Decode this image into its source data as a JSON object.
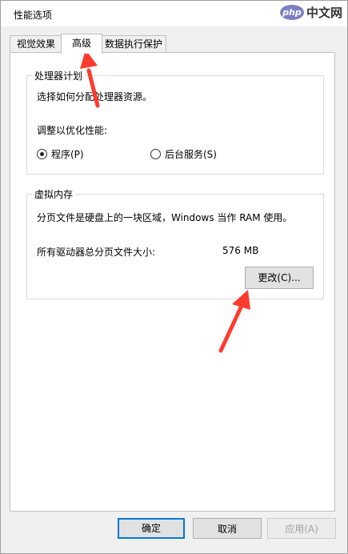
{
  "window": {
    "title": "性能选项"
  },
  "watermark": {
    "logo": "php",
    "text": "中文网"
  },
  "tabs": [
    {
      "label": "视觉效果",
      "active": false
    },
    {
      "label": "高级",
      "active": true
    },
    {
      "label": "数据执行保护",
      "active": false
    }
  ],
  "processor": {
    "group_title": "处理器计划",
    "description": "选择如何分配处理器资源。",
    "adjust_label": "调整以优化性能:",
    "options": [
      {
        "label": "程序(P)",
        "checked": true
      },
      {
        "label": "后台服务(S)",
        "checked": false
      }
    ]
  },
  "virtual_memory": {
    "group_title": "虚拟内存",
    "description": "分页文件是硬盘上的一块区域，Windows 当作 RAM 使用。",
    "total_label": "所有驱动器总分页文件大小:",
    "total_value": "576 MB",
    "change_button": "更改(C)..."
  },
  "footer": {
    "ok": "确定",
    "cancel": "取消",
    "apply": "应用(A)"
  },
  "annotation_color": "#ff3b2f"
}
